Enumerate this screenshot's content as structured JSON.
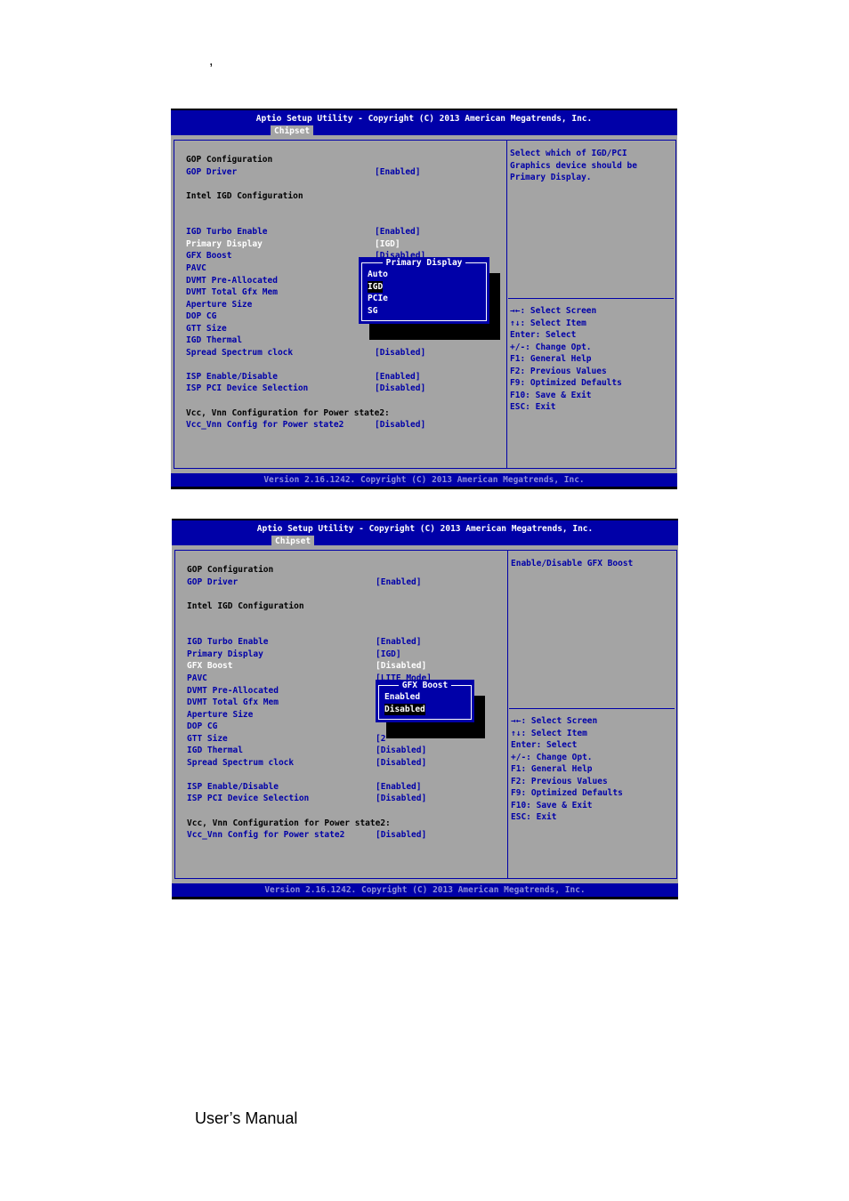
{
  "page": {
    "top_mark": ",",
    "footer": "User’s Manual"
  },
  "colors": {
    "bios_blue": "#0000a8",
    "bios_gray": "#a4a4a4",
    "text_blue": "#0000a8",
    "highlight": "#ffffff"
  },
  "screens": [
    {
      "title": "Aptio Setup Utility - Copyright (C) 2013 American Megatrends, Inc.",
      "tab": "Chipset",
      "rows": [
        {
          "row": 0,
          "label": "GOP Configuration",
          "style": "black"
        },
        {
          "row": 1,
          "label": "GOP Driver",
          "value": "[Enabled]",
          "style": "blue"
        },
        {
          "row": 3,
          "label": "Intel IGD Configuration",
          "style": "black"
        },
        {
          "row": 6,
          "label": "IGD Turbo Enable",
          "value": "[Enabled]",
          "style": "blue"
        },
        {
          "row": 7,
          "label": "Primary Display",
          "value": "[IGD]",
          "style": "white"
        },
        {
          "row": 8,
          "label": "GFX Boost",
          "value": "[Disabled]",
          "style": "blue"
        },
        {
          "row": 9,
          "label": "PAVC",
          "style": "blue"
        },
        {
          "row": 10,
          "label": "DVMT Pre-Allocated",
          "style": "blue"
        },
        {
          "row": 11,
          "label": "DVMT Total Gfx Mem",
          "style": "blue"
        },
        {
          "row": 12,
          "label": "Aperture Size",
          "style": "blue"
        },
        {
          "row": 13,
          "label": "DOP CG",
          "style": "blue"
        },
        {
          "row": 14,
          "label": "GTT Size",
          "style": "blue"
        },
        {
          "row": 15,
          "label": "IGD Thermal",
          "style": "blue"
        },
        {
          "row": 16,
          "label": "Spread Spectrum clock",
          "value": "[Disabled]",
          "style": "blue"
        },
        {
          "row": 18,
          "label": "ISP Enable/Disable",
          "value": "[Enabled]",
          "style": "blue"
        },
        {
          "row": 19,
          "label": "ISP PCI Device Selection",
          "value": "[Disabled]",
          "style": "blue"
        },
        {
          "row": 21,
          "label": "Vcc, Vnn Configuration for Power state2:",
          "style": "black"
        },
        {
          "row": 22,
          "label": "Vcc_Vnn Config for Power state2",
          "value": "[Disabled]",
          "style": "blue"
        }
      ],
      "help": [
        "Select which of IGD/PCI",
        "Graphics device should be",
        "Primary Display."
      ],
      "keys": [
        "→←: Select Screen",
        "↑↓: Select Item",
        "Enter: Select",
        "+/-: Change Opt.",
        "F1: General Help",
        "F2: Previous Values",
        "F9: Optimized Defaults",
        "F10: Save & Exit",
        "ESC: Exit"
      ],
      "popup": {
        "title": "Primary Display",
        "options": [
          "Auto",
          "IGD",
          "PCIe",
          "SG"
        ],
        "selected": "IGD"
      },
      "version": "Version 2.16.1242. Copyright (C) 2013 American Megatrends, Inc."
    },
    {
      "title": "Aptio Setup Utility - Copyright (C) 2013 American Megatrends, Inc.",
      "tab": "Chipset",
      "rows": [
        {
          "row": 0,
          "label": "GOP Configuration",
          "style": "black"
        },
        {
          "row": 1,
          "label": "GOP Driver",
          "value": "[Enabled]",
          "style": "blue"
        },
        {
          "row": 3,
          "label": "Intel IGD Configuration",
          "style": "black"
        },
        {
          "row": 6,
          "label": "IGD Turbo Enable",
          "value": "[Enabled]",
          "style": "blue"
        },
        {
          "row": 7,
          "label": "Primary Display",
          "value": "[IGD]",
          "style": "blue"
        },
        {
          "row": 8,
          "label": "GFX Boost",
          "value": "[Disabled]",
          "style": "white"
        },
        {
          "row": 9,
          "label": "PAVC",
          "value": "[LITE Mode]",
          "style": "blue"
        },
        {
          "row": 10,
          "label": "DVMT Pre-Allocated",
          "style": "blue"
        },
        {
          "row": 11,
          "label": "DVMT Total Gfx Mem",
          "style": "blue"
        },
        {
          "row": 12,
          "label": "Aperture Size",
          "style": "blue"
        },
        {
          "row": 13,
          "label": "DOP CG",
          "style": "blue"
        },
        {
          "row": 14,
          "label": "GTT Size",
          "value": "[2",
          "style": "blue"
        },
        {
          "row": 15,
          "label": "IGD Thermal",
          "value": "[Disabled]",
          "style": "blue"
        },
        {
          "row": 16,
          "label": "Spread Spectrum clock",
          "value": "[Disabled]",
          "style": "blue"
        },
        {
          "row": 18,
          "label": "ISP Enable/Disable",
          "value": "[Enabled]",
          "style": "blue"
        },
        {
          "row": 19,
          "label": "ISP PCI Device Selection",
          "value": "[Disabled]",
          "style": "blue"
        },
        {
          "row": 21,
          "label": "Vcc, Vnn Configuration for Power state2:",
          "style": "black"
        },
        {
          "row": 22,
          "label": "Vcc_Vnn Config for Power state2",
          "value": "[Disabled]",
          "style": "blue"
        }
      ],
      "help": [
        "Enable/Disable GFX Boost"
      ],
      "keys": [
        "→←: Select Screen",
        "↑↓: Select Item",
        "Enter: Select",
        "+/-: Change Opt.",
        "F1: General Help",
        "F2: Previous Values",
        "F9: Optimized Defaults",
        "F10: Save & Exit",
        "ESC: Exit"
      ],
      "popup": {
        "title": "GFX Boost",
        "options": [
          "Enabled",
          "Disabled"
        ],
        "selected": "Disabled"
      },
      "version": "Version 2.16.1242. Copyright (C) 2013 American Megatrends, Inc."
    }
  ]
}
